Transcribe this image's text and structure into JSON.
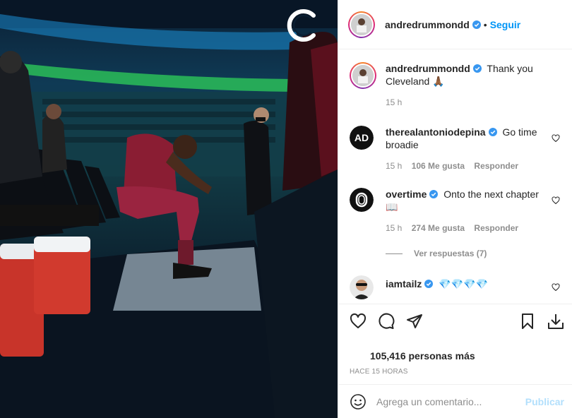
{
  "post": {
    "author": {
      "username": "andredrummondd",
      "verified": true
    },
    "header": {
      "separator": "•",
      "follow_label": "Seguir"
    },
    "caption": {
      "text": "Thank you Cleveland 🙏🏾",
      "time": "15 h"
    },
    "photo": {
      "team_logo": "cavaliers-c-logo"
    }
  },
  "comments": [
    {
      "username": "therealantoniodepina",
      "verified": true,
      "text": "Go time broadie",
      "time": "15 h",
      "likes": "106 Me gusta",
      "reply_label": "Responder"
    },
    {
      "username": "overtime",
      "verified": true,
      "text": "Onto the next chapter 📖",
      "time": "15 h",
      "likes": "274 Me gusta",
      "reply_label": "Responder"
    },
    {
      "username": "iamtailz",
      "verified": true,
      "text": "💎💎💎💎"
    }
  ],
  "view_replies": "Ver respuestas (7)",
  "actions": {
    "icons": [
      "heart-icon",
      "comment-icon",
      "share-icon",
      "bookmark-icon",
      "download-icon"
    ],
    "likes_text": "105,416 personas más",
    "timestamp": "HACE 15 HORAS"
  },
  "add_comment": {
    "placeholder": "Agrega un comentario...",
    "publish_label": "Publicar"
  },
  "colors": {
    "link": "#0095f6",
    "muted": "#8e8e8e",
    "text": "#262626",
    "publish_disabled": "#b2dffc"
  }
}
